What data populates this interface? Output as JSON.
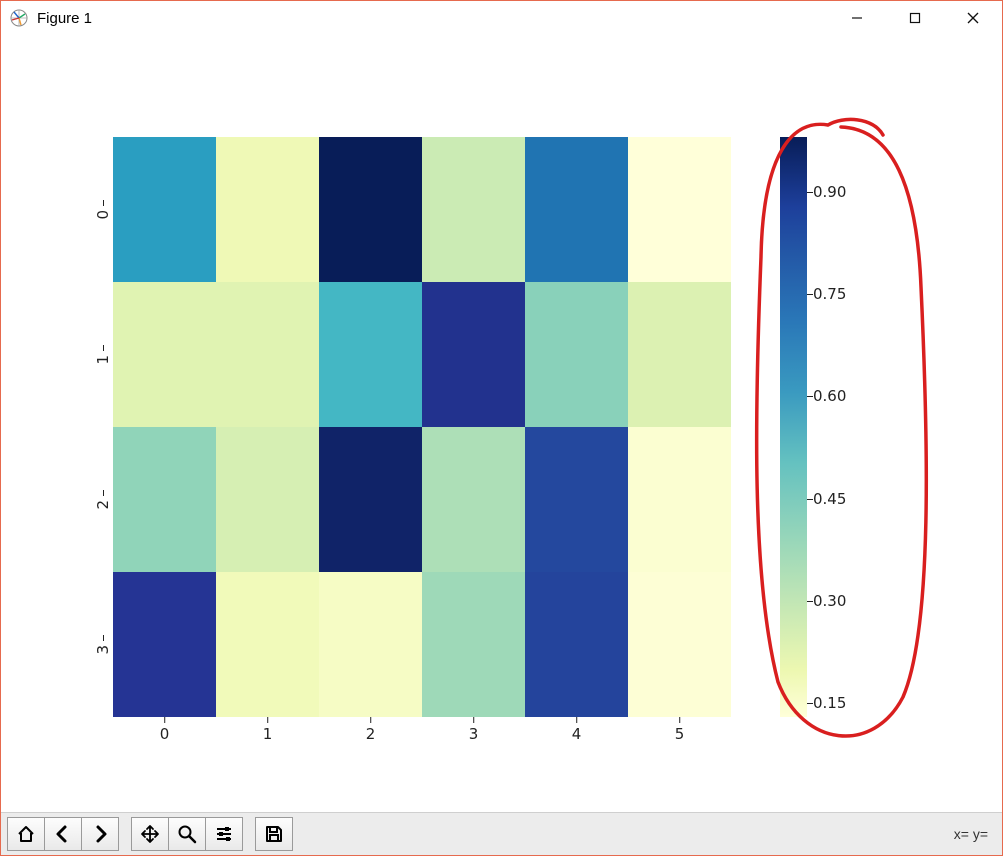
{
  "window": {
    "title": "Figure 1"
  },
  "status": {
    "text": "x= y="
  },
  "chart_data": {
    "type": "heatmap",
    "rows": 4,
    "cols": 6,
    "y_categories": [
      "0",
      "1",
      "2",
      "3"
    ],
    "x_categories": [
      "0",
      "1",
      "2",
      "3",
      "4",
      "5"
    ],
    "values": [
      [
        0.62,
        0.22,
        0.98,
        0.33,
        0.72,
        0.13
      ],
      [
        0.27,
        0.27,
        0.55,
        0.88,
        0.43,
        0.28
      ],
      [
        0.42,
        0.3,
        0.95,
        0.38,
        0.82,
        0.15
      ],
      [
        0.87,
        0.21,
        0.18,
        0.4,
        0.83,
        0.14
      ]
    ],
    "colorbar": {
      "vmin": 0.13,
      "vmax": 0.98,
      "ticks": [
        "0.15",
        "0.30",
        "0.45",
        "0.60",
        "0.75",
        "0.90"
      ],
      "colormap": "YlGnBu"
    },
    "annotation": {
      "kind": "freehand-circle",
      "color": "#d91f1f",
      "target": "colorbar"
    }
  }
}
